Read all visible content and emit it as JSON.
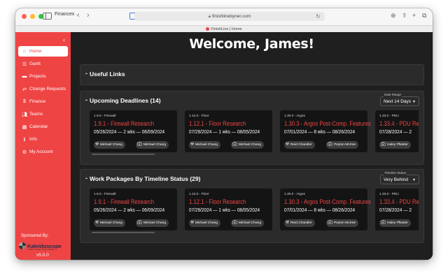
{
  "browser": {
    "tab_group": "Financex",
    "url": "finishlinebyner.com",
    "tab_title": "FinishLine | Home"
  },
  "sidebar": {
    "items": [
      {
        "label": "Home",
        "icon": "home-icon",
        "active": true
      },
      {
        "label": "Gantt",
        "icon": "gantt-icon"
      },
      {
        "label": "Projects",
        "icon": "folder-icon"
      },
      {
        "label": "Change Requests",
        "icon": "swap-icon"
      },
      {
        "label": "Finance",
        "icon": "dollar-icon"
      },
      {
        "label": "Teams",
        "icon": "people-icon"
      },
      {
        "label": "Calendar",
        "icon": "calendar-icon"
      },
      {
        "label": "Info",
        "icon": "info-icon"
      },
      {
        "label": "My Account",
        "icon": "gear-icon"
      }
    ],
    "sponsored_by": "Sponsored By:",
    "sponsor_name": "Kaleidoscope",
    "sponsor_tagline": "Where Design Meets Reality",
    "version": "v5.0.0"
  },
  "main": {
    "welcome": "Welcome, James!",
    "useful_links": "Useful Links",
    "deadlines": {
      "title": "Upcoming Deadlines (14)",
      "filter_label": "Date Range",
      "filter_value": "Next 14 Days",
      "cards": [
        {
          "sup": "1.9.0 - Firewall",
          "name": "1.9.1 - Firewall Research",
          "dates": "05/26/2024 — 2 wks — 06/09/2024",
          "lead": "Michael Chang",
          "manager": "Michael Chang"
        },
        {
          "sup": "1.12.0 - Floor",
          "name": "1.12.1 - Floor Research",
          "dates": "07/29/2024 — 1 wks — 08/05/2024",
          "lead": "Michael Chang",
          "manager": "Michael Chang"
        },
        {
          "sup": "1.30.0 - Argos",
          "name": "1.30.3 - Argos Post-Comp. Features",
          "dates": "07/01/2024 — 8 wks — 08/26/2024",
          "lead": "Reid Chandler",
          "manager": "Peyton McKee"
        },
        {
          "sup": "1.33.0 - PDU",
          "name": "1.33.4 - PDU Re",
          "dates": "07/28/2024 — 2",
          "lead": "",
          "manager": "Haley Pfiaster"
        }
      ]
    },
    "work_packages": {
      "title": "Work Packages By Timeline Status (29)",
      "filter_label": "Timeline Status",
      "filter_value": "Very Behind",
      "cards": [
        {
          "sup": "1.9.0 - Firewall",
          "name": "1.9.1 - Firewall Research",
          "dates": "05/26/2024 — 2 wks — 06/09/2024",
          "lead": "Michael Chang",
          "manager": "Michael Chang"
        },
        {
          "sup": "1.12.0 - Floor",
          "name": "1.12.1 - Floor Research",
          "dates": "07/29/2024 — 1 wks — 08/05/2024",
          "lead": "Michael Chang",
          "manager": "Michael Chang"
        },
        {
          "sup": "1.30.0 - Argos",
          "name": "1.30.3 - Argos Post-Comp. Features",
          "dates": "07/01/2024 — 8 wks — 08/26/2024",
          "lead": "Reid Chandler",
          "manager": "Peyton McKee"
        },
        {
          "sup": "1.33.0 - PDU",
          "name": "1.33.4 - PDU Re",
          "dates": "07/28/2024 — 2",
          "lead": "",
          "manager": "Haley Pfiaster"
        }
      ]
    }
  }
}
